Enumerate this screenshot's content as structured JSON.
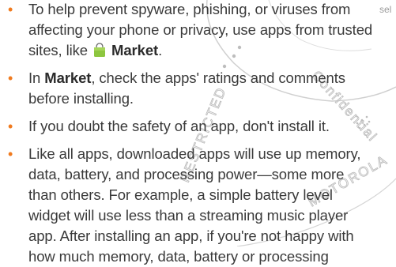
{
  "watermark": {
    "left_text": "RESTRICTED",
    "right_text": "Confidential",
    "corner_text": "sel",
    "bottom_text": "MOTOROLA"
  },
  "colors": {
    "bullet": "#f07a1e",
    "text": "#3a3a3a",
    "icon_bag": "#8dc63f",
    "watermark": "#c8c8c8"
  },
  "bullets": [
    {
      "lines": [
        "To help prevent spyware, phishing, or viruses from",
        "affecting your phone or privacy, use apps from trusted"
      ],
      "pre": "sites, like ",
      "icon": "market-bag-icon",
      "bold": "Market",
      "post": "."
    },
    {
      "pre": "In ",
      "bold": "Market",
      "post": ", check the apps' ratings and comments",
      "lines_after": [
        "before installing."
      ]
    },
    {
      "lines": [
        "If you doubt the safety of an app, don't install it."
      ]
    },
    {
      "lines": [
        "Like all apps, downloaded apps will use up memory,",
        "data, battery, and processing power—some more",
        "than others. For example, a simple battery level",
        "widget will use less than a streaming music player",
        "app. After installing an app, if you're not happy with",
        "how much memory, data, battery or processing"
      ]
    }
  ]
}
